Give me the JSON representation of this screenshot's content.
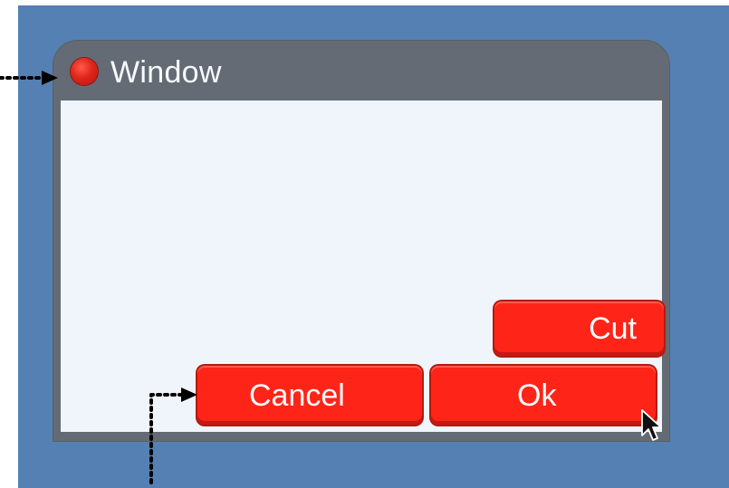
{
  "window": {
    "title": "Window",
    "title_icon": "red-circle"
  },
  "buttons": {
    "cut": "Cut",
    "cancel": "Cancel",
    "ok": "Ok"
  },
  "cursor": {
    "icon": "mouse-pointer"
  },
  "colors": {
    "desktop": "#5480b3",
    "window_frame": "#646b74",
    "content": "#f0f5fb",
    "button": "#ff2418",
    "button_text": "#ffffff",
    "annotation": "#000000"
  }
}
